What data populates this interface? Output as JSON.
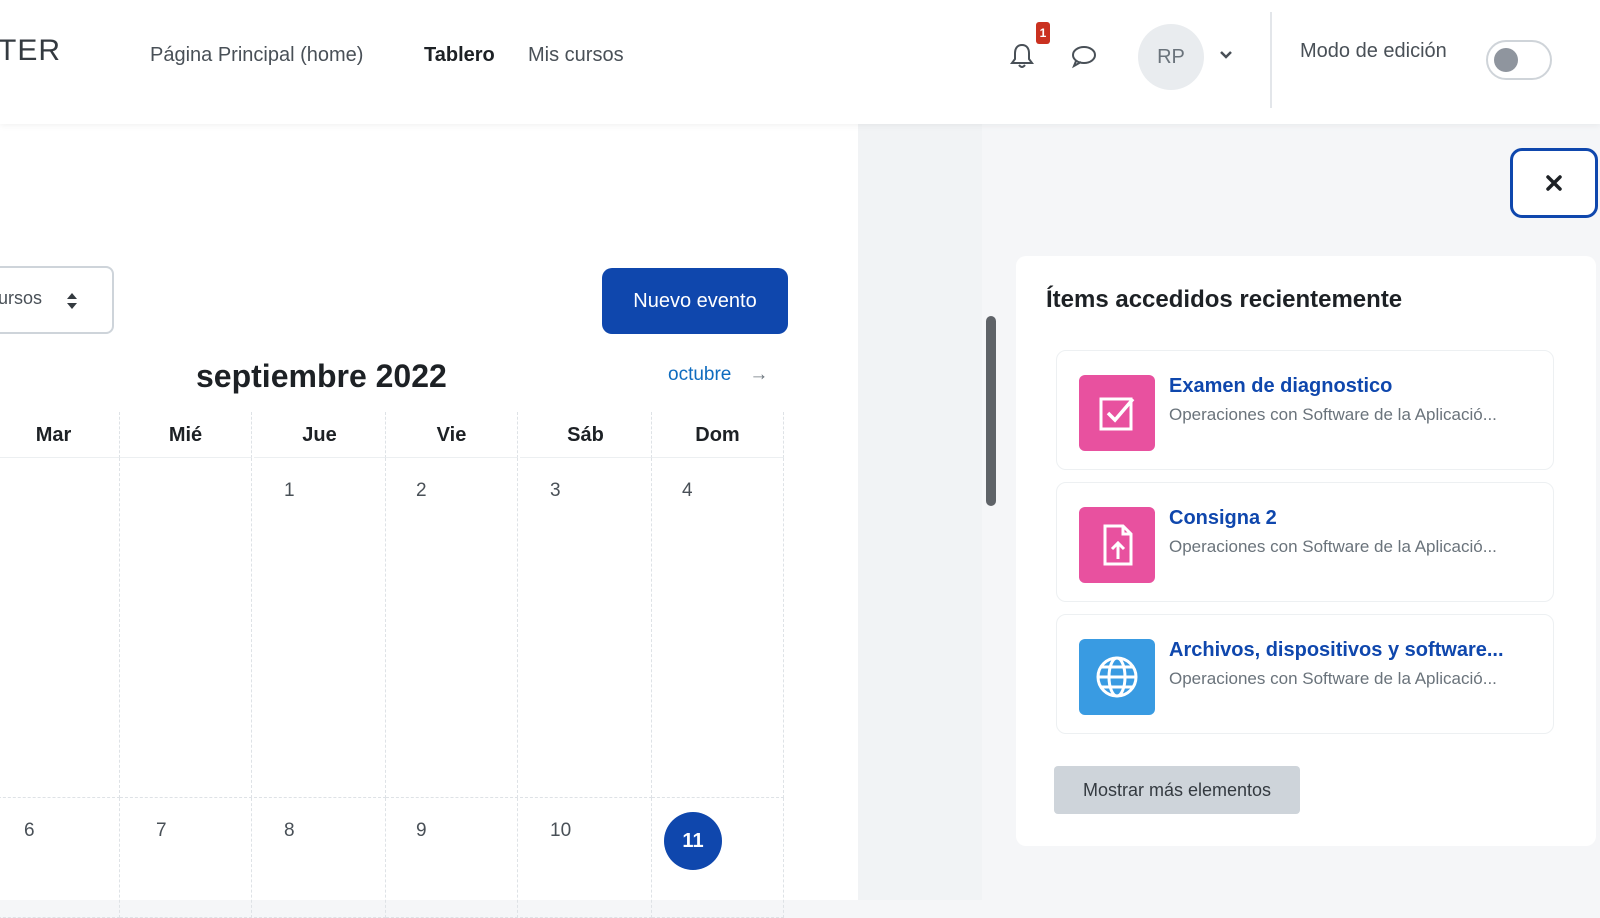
{
  "navbar": {
    "brand": "TER",
    "links": [
      {
        "label": "Página Principal (home)"
      },
      {
        "label": "Tablero",
        "active": true
      },
      {
        "label": "Mis cursos"
      }
    ],
    "notification_count": "1",
    "avatar_initials": "RP",
    "edit_mode_label": "Modo de edición",
    "edit_mode_on": false
  },
  "calendar": {
    "course_filter": "ursos",
    "new_event_label": "Nuevo evento",
    "month_title": "septiembre 2022",
    "next_month_label": "octubre",
    "next_arrow": "→",
    "weekdays": [
      "Mar",
      "Mié",
      "Jue",
      "Vie",
      "Sáb",
      "Dom"
    ],
    "week1": [
      "",
      "",
      "1",
      "2",
      "3",
      "4"
    ],
    "week2": [
      "6",
      "7",
      "8",
      "9",
      "10",
      "11"
    ],
    "today": "11",
    "accent": "#0f47ad"
  },
  "drawer": {
    "close_icon": "close-icon",
    "title": "Ítems accedidos recientemente",
    "items": [
      {
        "title": "Examen de diagnostico",
        "subtitle": "Operaciones con Software de la Aplicació...",
        "icon": "quiz-icon",
        "color": "#e8519f"
      },
      {
        "title": "Consigna 2",
        "subtitle": "Operaciones con Software de la Aplicació...",
        "icon": "assignment-icon",
        "color": "#e8519f"
      },
      {
        "title": "Archivos, dispositivos y software...",
        "subtitle": "Operaciones con Software de la Aplicació...",
        "icon": "url-globe-icon",
        "color": "#399be2"
      }
    ],
    "more_label": "Mostrar más elementos"
  }
}
